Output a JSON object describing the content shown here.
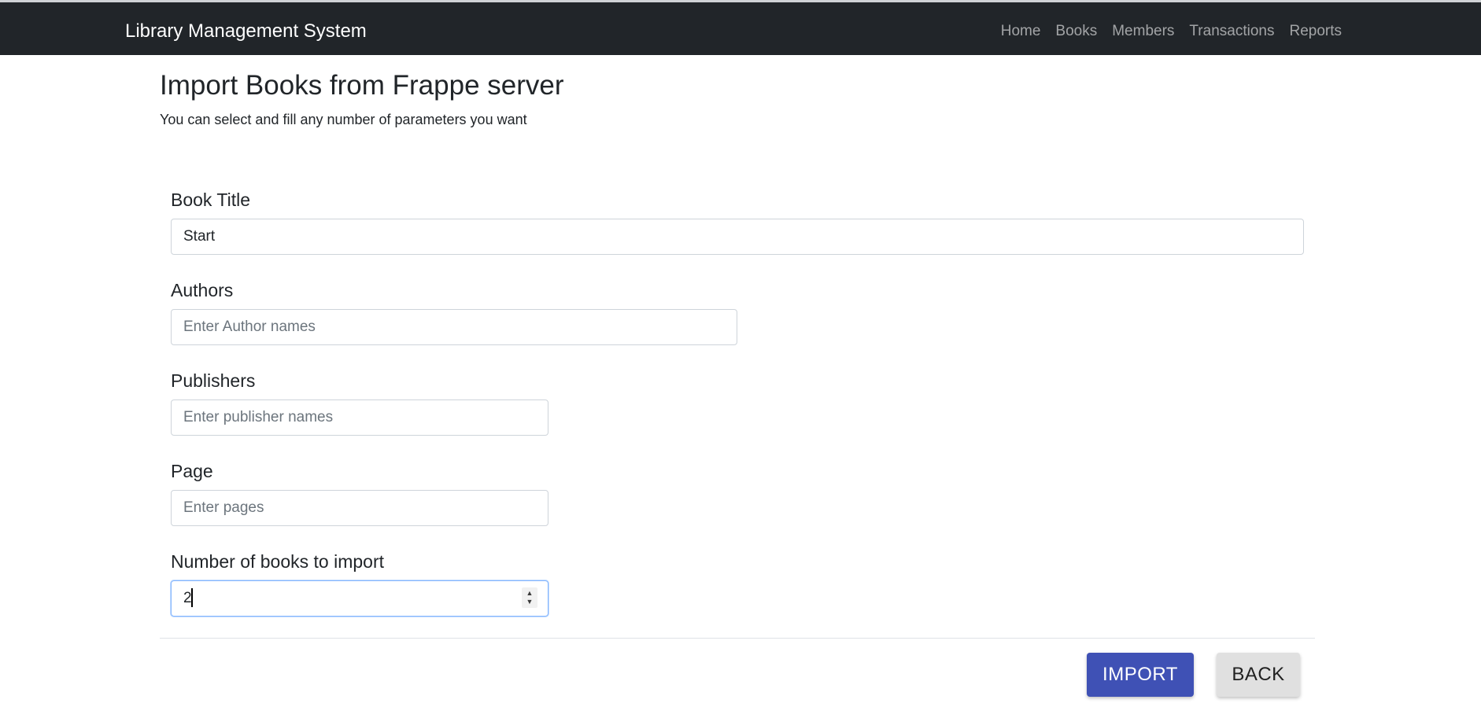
{
  "navbar": {
    "brand": "Library Management System",
    "links": [
      "Home",
      "Books",
      "Members",
      "Transactions",
      "Reports"
    ]
  },
  "page": {
    "title": "Import Books from Frappe server",
    "subtitle": "You can select and fill any number of parameters you want"
  },
  "form": {
    "book_title": {
      "label": "Book Title",
      "value": "Start",
      "placeholder": ""
    },
    "authors": {
      "label": "Authors",
      "value": "",
      "placeholder": "Enter Author names"
    },
    "publishers": {
      "label": "Publishers",
      "value": "",
      "placeholder": "Enter publisher names"
    },
    "page": {
      "label": "Page",
      "value": "",
      "placeholder": "Enter pages"
    },
    "num_books": {
      "label": "Number of books to import",
      "value": "2",
      "placeholder": ""
    }
  },
  "actions": {
    "import_label": "IMPORT",
    "back_label": "BACK"
  },
  "colors": {
    "navbar_bg": "#212529",
    "import_button": "#3f51b5",
    "back_button": "#e0e0e0",
    "focus_border": "#86b7fe"
  },
  "icons": {
    "stepper": "stepper-arrows-icon"
  }
}
